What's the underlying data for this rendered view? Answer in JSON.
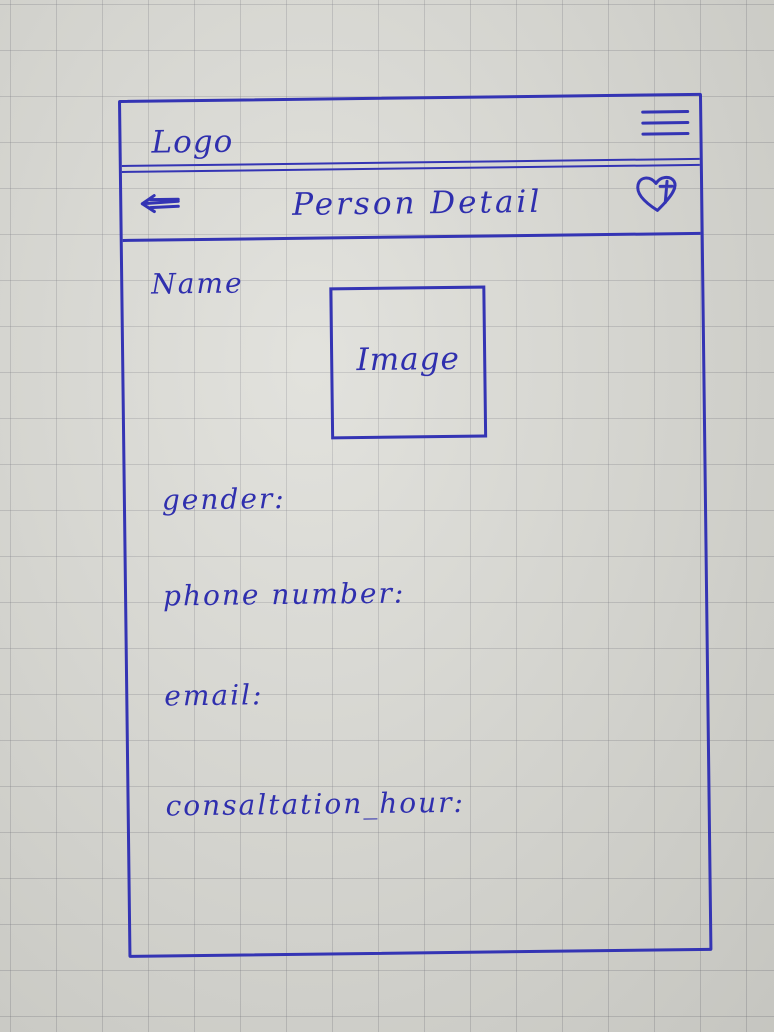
{
  "header": {
    "logo_text": "Logo",
    "menu_icon": "hamburger-menu-icon"
  },
  "navbar": {
    "title": "Person Detail",
    "back_icon": "back-arrow-icon",
    "favorite_icon": "heart-add-icon"
  },
  "detail": {
    "name_label": "Name",
    "image_placeholder": "Image",
    "gender_label": "gender:",
    "phone_label": "phone number:",
    "email_label": "email:",
    "consultation_label": "consaltation_hour:"
  },
  "colors": {
    "ink": "#3434b4",
    "paper": "#dcdcd6"
  }
}
